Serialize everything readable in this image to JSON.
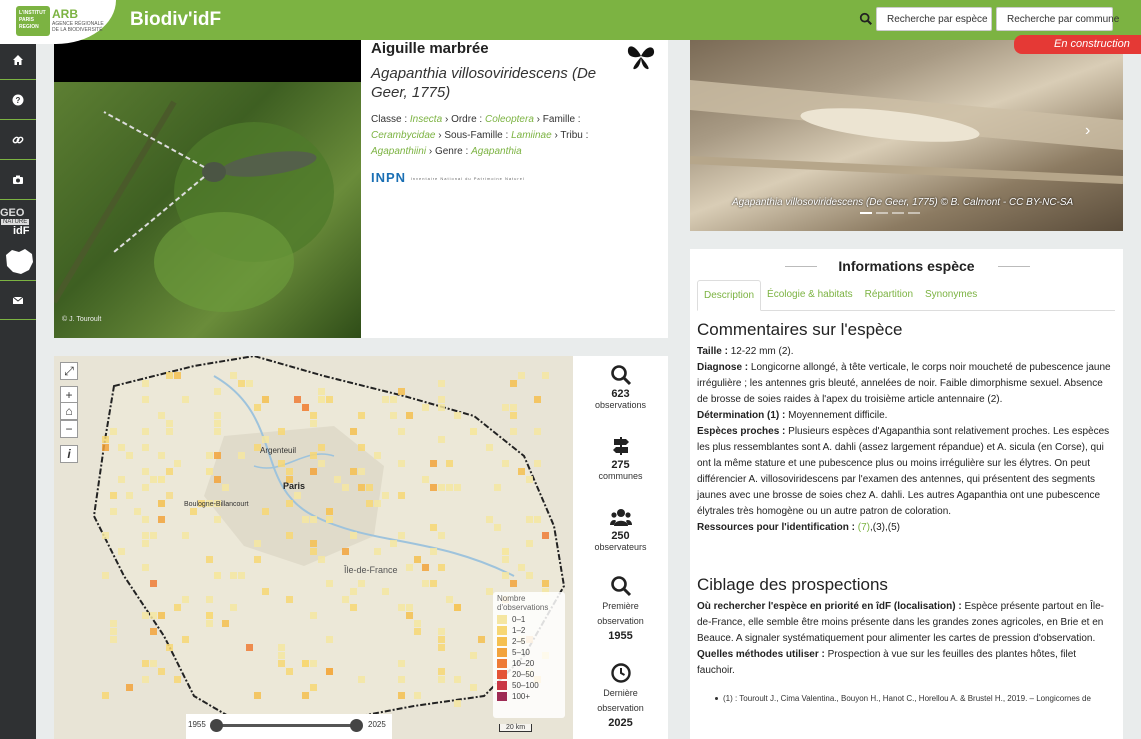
{
  "header": {
    "logo_badge": "L'INSTITUT PARIS REGION",
    "logo_title": "ARB",
    "logo_subtitle": "AGENCE RÉGIONALE DE LA BIODIVERSITÉ",
    "brand": "Biodiv'idF",
    "search_species_label": "Recherche par espèce",
    "search_commune_label": "Recherche par commune",
    "construction": "En construction"
  },
  "sidebar": {
    "items": [
      {
        "icon": "home-icon"
      },
      {
        "icon": "question-icon"
      },
      {
        "icon": "link-icon"
      },
      {
        "icon": "camera-icon"
      },
      {
        "icon": "envelope-icon"
      }
    ],
    "geo_logo": {
      "line1": "GEO",
      "line2": "NATURE",
      "line3": "idF"
    }
  },
  "species": {
    "common_name": "Aiguille marbrée",
    "latin_name": "Agapanthia villosoviridescens (De Geer, 1775)",
    "photo_credit": "© J. Touroult",
    "taxonomy": {
      "classe_label": "Classe :",
      "classe": "Insecta",
      "ordre_label": "Ordre :",
      "ordre": "Coleoptera",
      "famille_label": "Famille :",
      "famille": "Cerambycidae",
      "sous_famille_label": "Sous-Famille :",
      "sous_famille": "Lamiinae",
      "tribu_label": "Tribu :",
      "tribu": "Agapanthiini",
      "genre_label": "Genre :",
      "genre": "Agapanthia"
    },
    "inpn": "INPN",
    "inpn_small": "Inventaire National du Patrimoine Naturel",
    "photo2_caption": "Agapanthia villosoviridescens (De Geer, 1775) © B. Calmont - CC BY-NC-SA"
  },
  "map": {
    "legend_title": "Nombre d'observations",
    "legend": [
      {
        "label": "0–1",
        "color": "#f5e6a1"
      },
      {
        "label": "1–2",
        "color": "#f7d774"
      },
      {
        "label": "2–5",
        "color": "#f5c050"
      },
      {
        "label": "5–10",
        "color": "#f2a33c"
      },
      {
        "label": "10–20",
        "color": "#ee7b36"
      },
      {
        "label": "20–50",
        "color": "#e45437"
      },
      {
        "label": "50–100",
        "color": "#c93745"
      },
      {
        "label": "100+",
        "color": "#9e2b55"
      }
    ],
    "slider_min": "1955",
    "slider_max": "2025",
    "scale": "20 km",
    "labels": {
      "paris": "Paris",
      "argenteuil": "Argenteuil",
      "idf": "Île-de-France",
      "boulogne": "Boulogne-Billancourt"
    }
  },
  "stats": [
    {
      "icon": "search-icon",
      "value": "623",
      "label": "observations"
    },
    {
      "icon": "signpost-icon",
      "value": "275",
      "label": "communes"
    },
    {
      "icon": "users-icon",
      "value": "250",
      "label": "observateurs"
    },
    {
      "icon": "search-icon",
      "label1": "Première",
      "label2": "observation",
      "value": "1955"
    },
    {
      "icon": "clock-icon",
      "label1": "Dernière",
      "label2": "observation",
      "value": "2025"
    }
  ],
  "info": {
    "title": "Informations espèce",
    "tabs": [
      "Description",
      "Écologie & habitats",
      "Répartition",
      "Synonymes"
    ],
    "commentaires_title": "Commentaires sur l'espèce",
    "taille_label": "Taille :",
    "taille": " 12-22 mm (2).",
    "diagnose_label": "Diagnose :",
    "diagnose": " Longicorne allongé, à tête verticale, le corps noir moucheté de pubescence jaune irrégulière ; les antennes gris bleuté, annelées de noir. Faible dimorphisme sexuel. Absence de brosse de soies raides à l'apex du troisième article antennaire (2).",
    "determination_label": "Détermination (1) :",
    "determination": " Moyennement difficile.",
    "proches_label": "Espèces proches :",
    "proches": " Plusieurs espèces d'Agapanthia sont relativement proches. Les espèces les plus ressemblantes sont A. dahli (assez largement répandue) et A. sicula (en Corse), qui ont la même stature et une pubescence plus ou moins irrégulière sur les élytres. On peut différencier A. villosoviridescens par l'examen des antennes, qui présentent des segments jaunes avec une brosse de soies chez A. dahli. Les autres Agapanthia ont une pubescence élytrales très homogène ou un autre patron de coloration.",
    "ressources_label": "Ressources pour l'identification :",
    "ressources_link": "(7)",
    "ressources_rest": ",(3),(5)",
    "ciblage_title": "Ciblage des prospections",
    "ou_label": "Où rechercher l'espèce en priorité en îdF (localisation) :",
    "ou": " Espèce présente partout en Île-de-France, elle semble être moins présente dans les grandes zones agricoles, en Brie et en Beauce. A signaler systématiquement pour alimenter les cartes de pression d'observation.",
    "methodes_label": "Quelles méthodes utiliser :",
    "methodes": " Prospection à vue sur les feuilles des plantes hôtes, filet fauchoir.",
    "reference": "(1) : Touroult J., Cima Valentina., Bouyon H., Hanot C., Horellou A. & Brustel H., 2019. – Longicornes de"
  }
}
